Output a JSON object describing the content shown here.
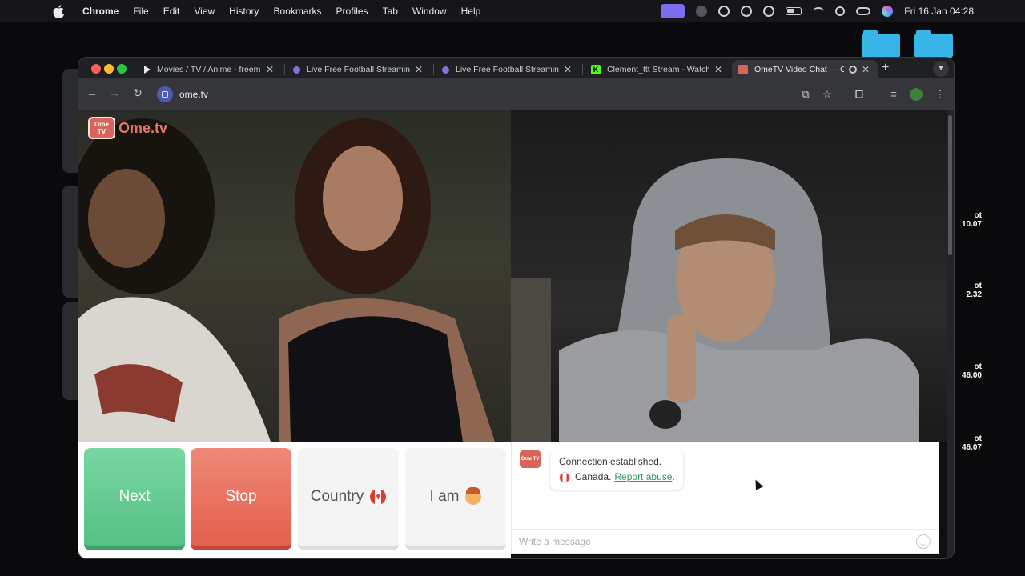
{
  "menubar": {
    "app_name": "Chrome",
    "items": [
      "File",
      "Edit",
      "View",
      "History",
      "Bookmarks",
      "Profiles",
      "Tab",
      "Window",
      "Help"
    ],
    "clock": "Fri 16 Jan  04:28"
  },
  "desktop": {
    "widgets": [
      "ot\n10.07",
      "ot\n2.32",
      "ot\n46.00",
      "ot\n46.07"
    ]
  },
  "tabs": [
    {
      "title": "Movies / TV / Anime - freem",
      "favicon": "play-icon",
      "active": false
    },
    {
      "title": "Live Free Football Streaming",
      "favicon": "football-icon",
      "active": false
    },
    {
      "title": "Live Free Football Streaming",
      "favicon": "football-icon",
      "active": false
    },
    {
      "title": "Clement_ttt Stream - Watch",
      "favicon": "kick-icon",
      "active": false
    },
    {
      "title": "OmeTV Video Chat — On",
      "favicon": "ometv-icon",
      "active": true
    }
  ],
  "toolbar": {
    "url": "ome.tv"
  },
  "logo": {
    "badge": "Ome TV",
    "text": "Ome.tv"
  },
  "controls": {
    "next_label": "Next",
    "stop_label": "Stop",
    "country_label": "Country",
    "iam_label": "I am"
  },
  "chat": {
    "logo_text": "Ome TV",
    "status": "Connection established.",
    "country": "Canada.",
    "report_link": "Report abuse",
    "report_suffix": ".",
    "input_placeholder": "Write a message"
  },
  "colors": {
    "next": "#55c186",
    "stop": "#e3604d",
    "brand": "#d9645a",
    "link": "#2e9b63"
  }
}
